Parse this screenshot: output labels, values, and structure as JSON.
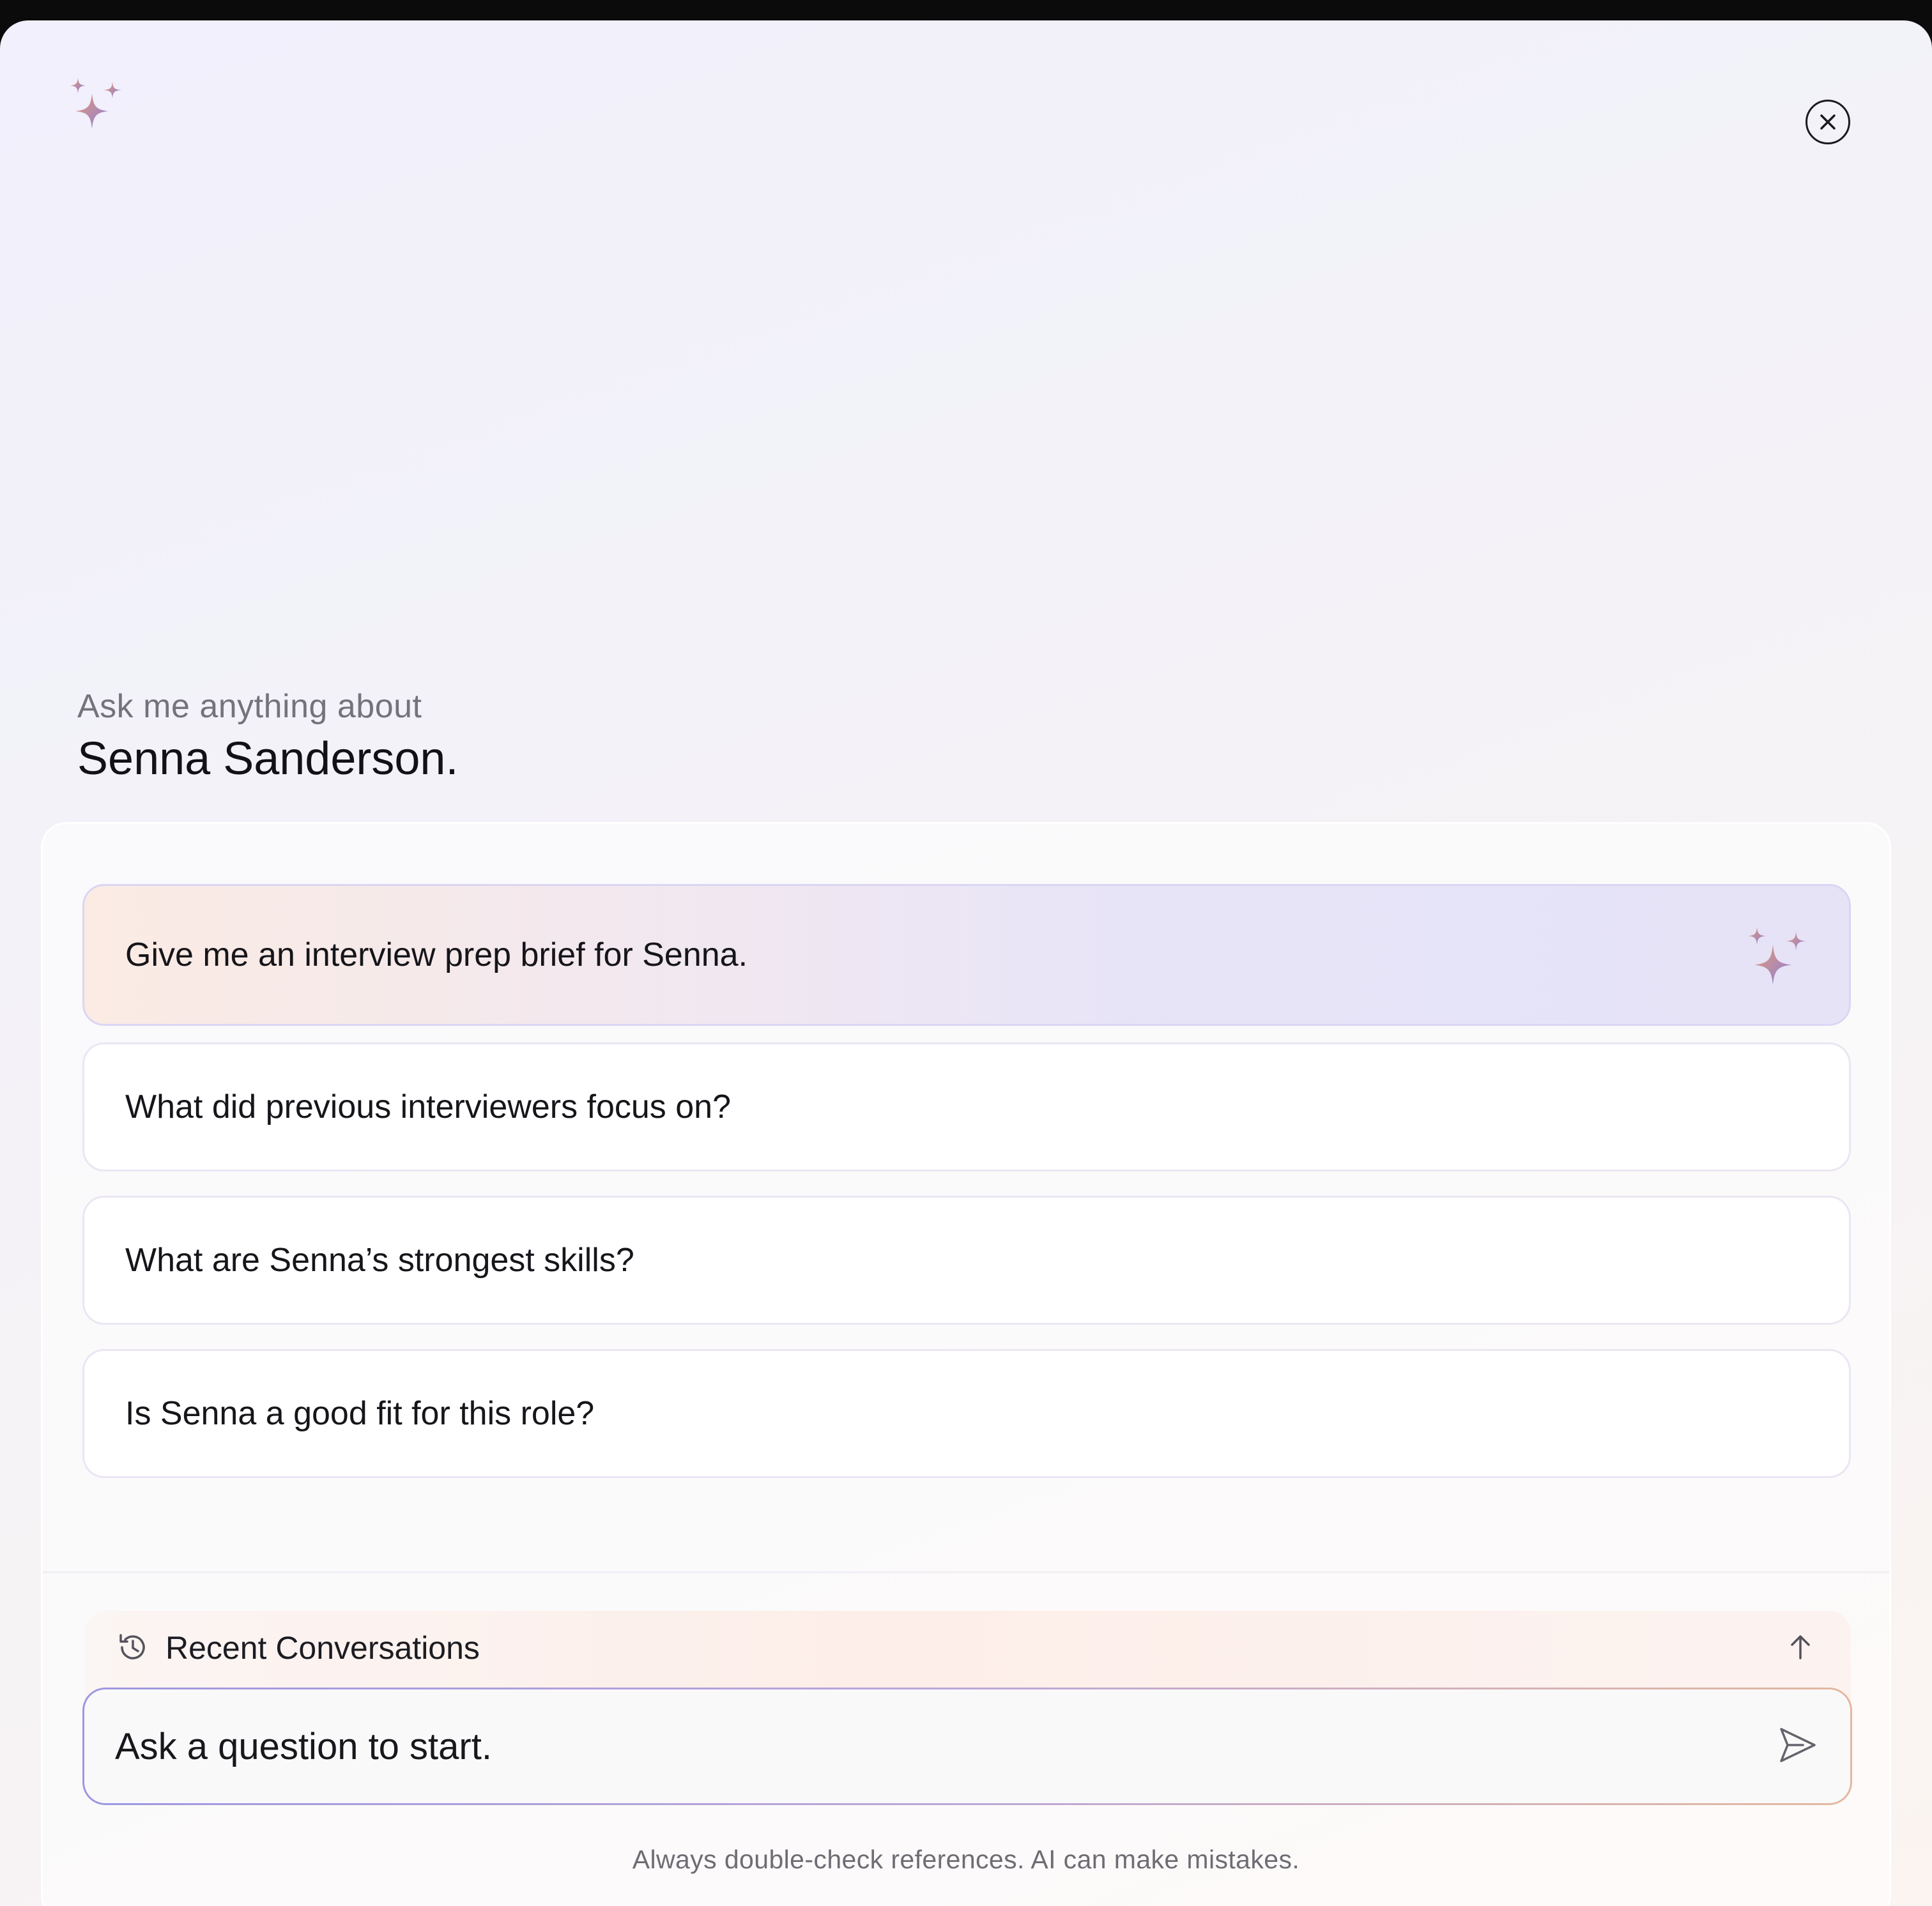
{
  "header": {
    "logo_icon": "sparkle-icon",
    "close_icon": "close-circle-icon"
  },
  "intro": {
    "subtitle": "Ask me anything about",
    "name": "Senna Sanderson."
  },
  "suggestions": [
    {
      "label": "Give me an interview prep brief for Senna.",
      "icon": "sparkle-icon",
      "highlighted": true
    },
    {
      "label": "What did previous interviewers focus on?",
      "highlighted": false
    },
    {
      "label": "What are Senna’s strongest skills?",
      "highlighted": false
    },
    {
      "label": "Is Senna a good fit for this role?",
      "highlighted": false
    }
  ],
  "recent": {
    "label": "Recent Conversations",
    "icon": "history-icon",
    "toggle_icon": "arrow-up-icon"
  },
  "composer": {
    "placeholder": "Ask a question to start.",
    "value": "",
    "send_icon": "send-icon"
  },
  "disclaimer": "Always double-check references. AI can make mistakes.",
  "colors": {
    "accent_purple": "#8f86d9",
    "accent_peach": "#e9a07a",
    "text_primary": "#111116",
    "text_muted": "#75727c"
  }
}
